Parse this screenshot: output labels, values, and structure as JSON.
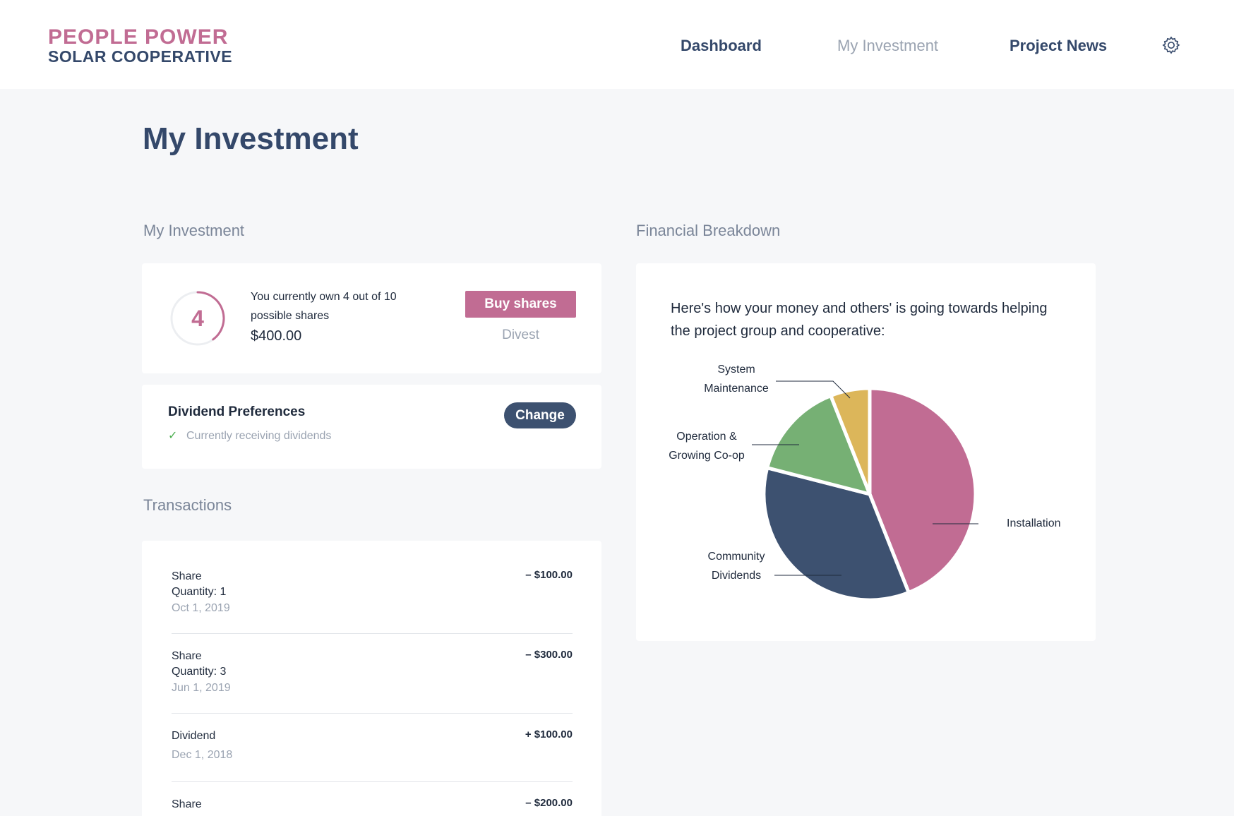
{
  "brand": {
    "line1": "PEOPLE POWER",
    "line2": "SOLAR COOPERATIVE",
    "colors": {
      "pink": "#c16c93",
      "navy": "#34486a"
    }
  },
  "nav": {
    "items": [
      {
        "label": "Dashboard",
        "active": false
      },
      {
        "label": "My Investment",
        "active": true
      },
      {
        "label": "Project News",
        "active": false
      }
    ],
    "settings_icon": "gear-icon"
  },
  "page": {
    "title": "My Investment"
  },
  "investment": {
    "section_label": "My Investment",
    "shares_owned": "4",
    "shares_owned_value": 4,
    "shares_possible_value": 10,
    "ownership_text": "You currently own 4 out of 10 possible shares",
    "amount": "$400.00",
    "buy_label": "Buy shares",
    "divest_label": "Divest"
  },
  "dividends": {
    "title": "Dividend Preferences",
    "status": "Currently receiving dividends",
    "status_icon": "check-icon",
    "change_label": "Change"
  },
  "transactions": {
    "section_label": "Transactions",
    "items": [
      {
        "type": "Share",
        "quantity": "Quantity: 1",
        "date": "Oct 1, 2019",
        "amount": "– $100.00"
      },
      {
        "type": "Share",
        "quantity": "Quantity: 3",
        "date": "Jun 1, 2019",
        "amount": "– $300.00"
      },
      {
        "type": "Dividend",
        "quantity": "",
        "date": "Dec 1, 2018",
        "amount": "+ $100.00"
      },
      {
        "type": "Share",
        "quantity": "",
        "date": "",
        "amount": "– $200.00"
      }
    ]
  },
  "financial": {
    "section_label": "Financial Breakdown",
    "intro": "Here's how your money and others' is going towards helping the project group and cooperative:",
    "chart_data": {
      "type": "pie",
      "categories": [
        "Installation",
        "Community Dividends",
        "Operation & Growing Co-op",
        "System Maintenance"
      ],
      "values": [
        44,
        35,
        15,
        6
      ],
      "colors": [
        "#c16c93",
        "#3d5170",
        "#76b074",
        "#dcb65a"
      ],
      "label_lines": [
        [
          "Installation"
        ],
        [
          "Community",
          "Dividends"
        ],
        [
          "Operation &",
          "Growing Co-op"
        ],
        [
          "System",
          "Maintenance"
        ]
      ]
    }
  }
}
